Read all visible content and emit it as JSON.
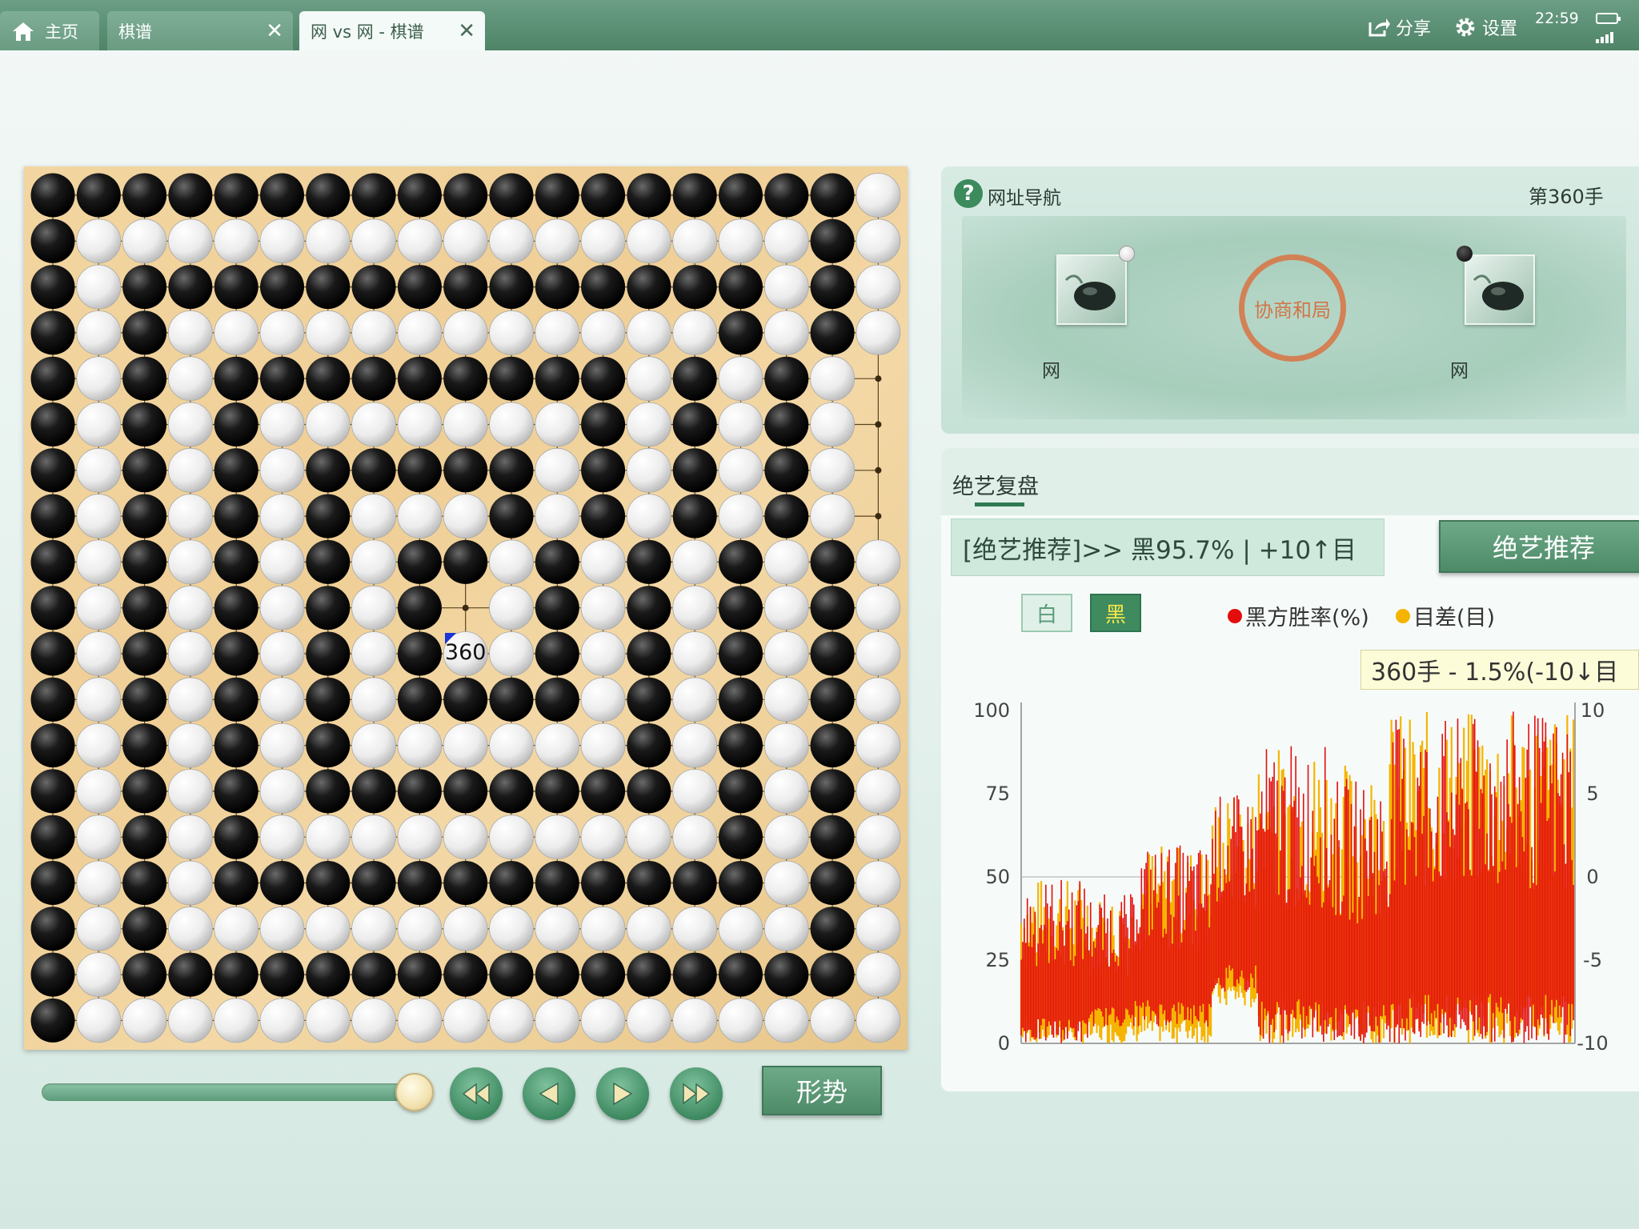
{
  "tabs": [
    {
      "label": "主页",
      "icon": "home-icon"
    },
    {
      "label": "棋谱",
      "close": "✕"
    },
    {
      "label": "网 vs 网 - 棋谱",
      "close": "✕"
    }
  ],
  "top_actions": {
    "share": "分享",
    "settings": "设置"
  },
  "status": {
    "time": "22:59"
  },
  "board": {
    "size": 19,
    "last_move_number": "360",
    "rows": [
      "BBBBBBBBBBBBBBBBBBW",
      "BWWWWWWWWWWWWWWWWBW",
      "BWBBBBBBBBBBBBBBWBW",
      "BWBWWWWWWWWWWWWBWBW",
      "BWBWBBBBBBBBBWBWBW",
      "BWBWBWWWWWWWBWBWBW",
      "BWBWBWBBBBBWBWBWBW",
      "BWBWBWBWWWBWBWBWBW",
      "BWBWBWBWBBWBWBWBWBW",
      "BWBWBWBWB.WBWBWBWBW",
      "BWBWBWBWBWWBWBWBWBW",
      "BWBWBWBWBBBBWBWBWBW",
      "BWBWBWBWWWWWWBWBWBW",
      "BWBWBWBBBBBBBBWBWBW",
      "BWBWBWWWWWWWWWWBWBW",
      "BWBWBBBBBBBBBBBBWBW",
      "BWBWWWWWWWWWWWWWWBW",
      "BWBBBBBBBBBBBBBBBBW",
      "BWWWWWWWWWWWWWWWWWW"
    ]
  },
  "controls": {
    "situation_button": "形势",
    "slider_fraction": 0.93
  },
  "info": {
    "title": "网址导航",
    "move_count": "第360手",
    "white_player": "网",
    "black_player": "网",
    "result": "协商和局"
  },
  "analysis": {
    "tab": "绝艺复盘",
    "recommendation": "[绝艺推荐]>> 黑95.7% | +10↑目",
    "recommend_button": "绝艺推荐",
    "toggle_white": "白",
    "toggle_black": "黑",
    "legend_winrate": "黑方胜率(%)",
    "legend_diff": "目差(目)",
    "tooltip": "360手 - 1.5%(-10↓目"
  },
  "colors": {
    "winrate": "#e40d0d",
    "diff": "#f5b400",
    "accent": "#4d8a68"
  },
  "chart_data": {
    "type": "area",
    "title": "",
    "x_range": [
      1,
      360
    ],
    "y_left": {
      "ticks": [
        "100",
        "75",
        "50",
        "25",
        "0"
      ],
      "ylim": [
        0,
        100
      ]
    },
    "y_right": {
      "ticks": [
        "10",
        "5",
        "0",
        "-5",
        "-10"
      ],
      "ylim": [
        -10,
        10
      ]
    },
    "series": [
      {
        "name": "黑方胜率(%)",
        "segments": [
          {
            "from": 1,
            "to": 45,
            "min": 0,
            "max": 50
          },
          {
            "from": 45,
            "to": 75,
            "min": 5,
            "max": 45
          },
          {
            "from": 75,
            "to": 125,
            "min": 5,
            "max": 60
          },
          {
            "from": 125,
            "to": 155,
            "min": 15,
            "max": 75
          },
          {
            "from": 155,
            "to": 200,
            "min": 0,
            "max": 90
          },
          {
            "from": 200,
            "to": 240,
            "min": 0,
            "max": 80
          },
          {
            "from": 240,
            "to": 300,
            "min": 0,
            "max": 98
          },
          {
            "from": 300,
            "to": 360,
            "min": 0,
            "max": 100
          }
        ]
      },
      {
        "name": "目差(目)",
        "segments": [
          {
            "from": 1,
            "to": 45,
            "min": -10,
            "max": 0
          },
          {
            "from": 45,
            "to": 75,
            "min": -10,
            "max": -1
          },
          {
            "from": 75,
            "to": 125,
            "min": -10,
            "max": 2
          },
          {
            "from": 125,
            "to": 155,
            "min": -8,
            "max": 5
          },
          {
            "from": 155,
            "to": 200,
            "min": -10,
            "max": 8
          },
          {
            "from": 200,
            "to": 240,
            "min": -10,
            "max": 7
          },
          {
            "from": 240,
            "to": 300,
            "min": -10,
            "max": 10
          },
          {
            "from": 300,
            "to": 360,
            "min": -10,
            "max": 10
          }
        ]
      }
    ],
    "reference_line": 50,
    "grid": false
  }
}
